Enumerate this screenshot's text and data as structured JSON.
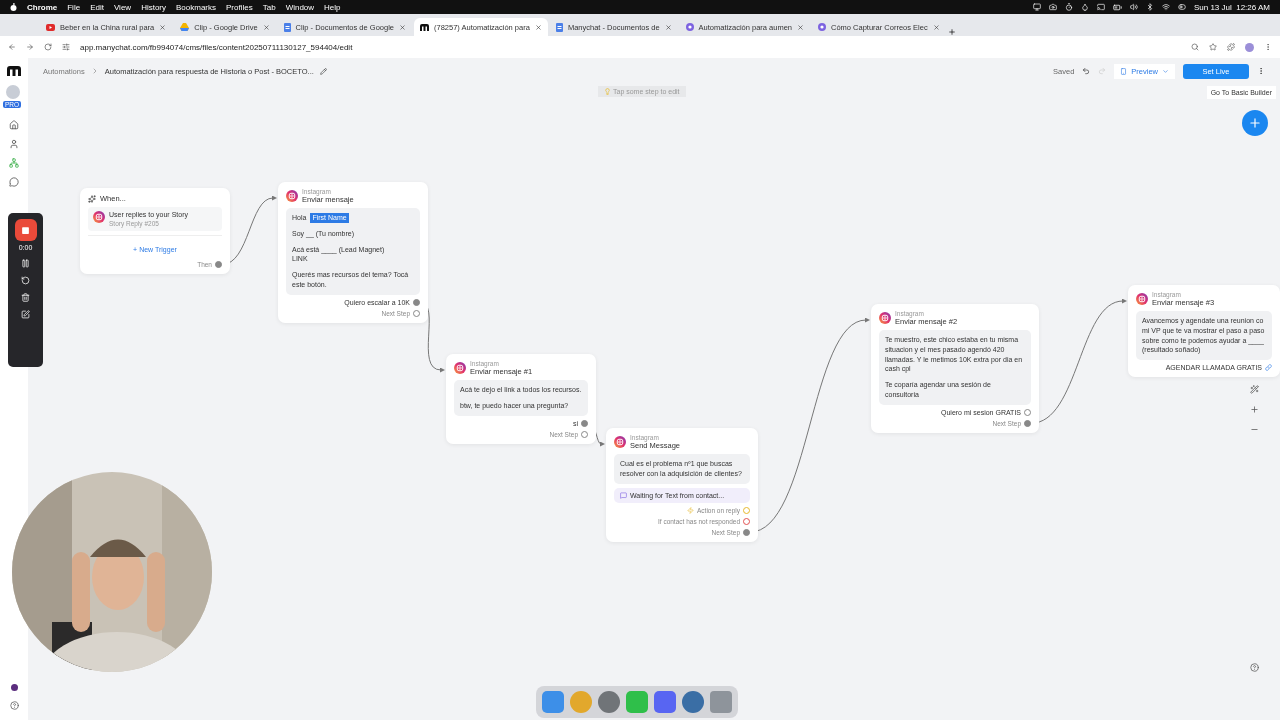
{
  "menu_bar": {
    "app": "Chrome",
    "menus": [
      "File",
      "Edit",
      "View",
      "History",
      "Bookmarks",
      "Profiles",
      "Tab",
      "Window",
      "Help"
    ],
    "clock": "Sun 13 Jul  12:26 AM"
  },
  "tabs": [
    {
      "title": "Beber en la China rural para",
      "kind": "video",
      "selected": false
    },
    {
      "title": "Clip - Google Drive",
      "kind": "drive",
      "selected": false
    },
    {
      "title": "Clip - Documentos de Google",
      "kind": "doc",
      "selected": false
    },
    {
      "title": "(78257) Automatización para",
      "kind": "app",
      "selected": true
    },
    {
      "title": "Manychat - Documentos de",
      "kind": "doc",
      "selected": false
    },
    {
      "title": "Automatización para aumen",
      "kind": "site",
      "selected": false
    },
    {
      "title": "Cómo Capturar Correos Elec",
      "kind": "site",
      "selected": false
    }
  ],
  "address_bar": {
    "url": "app.manychat.com/fb994074/cms/files/content20250711130127_594404/edit"
  },
  "sidebar": {
    "badge": "PRO"
  },
  "header": {
    "breadcrumb": "Automations",
    "title": "Automatización para respuesta de Historia o Post - BOCETO...",
    "status": "Saved",
    "preview": "Preview",
    "publish": "Set Live",
    "builder_link": "Go To Basic Builder"
  },
  "canvas": {
    "hint": "Tap some step to edit",
    "trigger": {
      "title": "When...",
      "items": [
        {
          "label": "User replies to your Story",
          "detail": "Story Reply #205"
        }
      ],
      "add_label": "+ New Trigger",
      "output": "Then"
    },
    "steps": [
      {
        "channel": "Instagram",
        "title": "Enviar mensaje",
        "paragraphs": [
          {
            "text": "Hola",
            "variable": "First Name"
          },
          {
            "text": "Soy __ (Tu nombre)"
          },
          {
            "text": "Acá está ____ (Lead Magnet)\nLINK"
          },
          {
            "text": "Querés mas recursos del tema? Tocá este botón."
          }
        ],
        "buttons": [
          {
            "label": "Quiero escalar a 10K",
            "connected": true
          }
        ],
        "outputs": [
          {
            "label": "Next Step",
            "kind": "next",
            "connected": false
          }
        ]
      },
      {
        "channel": "Instagram",
        "title": "Enviar mensaje #1",
        "paragraphs": [
          {
            "text": "Acá te dejo el link a todos los recursos."
          },
          {
            "text": "btw, te puedo hacer una pregunta?"
          }
        ],
        "buttons": [
          {
            "label": "si",
            "connected": true
          }
        ],
        "outputs": [
          {
            "label": "Next Step",
            "kind": "next",
            "connected": false
          }
        ]
      },
      {
        "channel": "Instagram",
        "title": "Send Message",
        "paragraphs": [
          {
            "text": "Cual es el problema nº1 que buscas resolver con la adquisición de clientes?"
          }
        ],
        "waiting": "Waiting for Text from contact...",
        "outputs": [
          {
            "label": "Action on reply",
            "kind": "action",
            "connected": false
          },
          {
            "label": "If contact has not responded",
            "kind": "timeout",
            "connected": false
          },
          {
            "label": "Next Step",
            "kind": "next",
            "connected": true
          }
        ]
      },
      {
        "channel": "Instagram",
        "title": "Enviar mensaje #2",
        "paragraphs": [
          {
            "text": "Te muestro, este chico estaba en tu misma situacion y el mes pasado agendó 420 llamadas. Y le metimos 10K extra por dia en cash cpl"
          },
          {
            "text": "Te coparía agendar una sesión de consultoria"
          }
        ],
        "buttons": [
          {
            "label": "Quiero mi sesion GRATIS",
            "connected": false
          }
        ],
        "outputs": [
          {
            "label": "Next Step",
            "kind": "next",
            "connected": true
          }
        ]
      },
      {
        "channel": "Instagram",
        "title": "Enviar mensaje #3",
        "paragraphs": [
          {
            "text": "Avancemos y agendate una reunion co\nmi VP que te va mostrar el paso a paso\nsobre como te podemos ayudar a ____\n(resultado soñado)"
          }
        ],
        "buttons": [
          {
            "label": "AGENDAR LLAMADA GRATIS",
            "kind": "link"
          }
        ]
      }
    ]
  },
  "recorder": {
    "time": "0:00"
  }
}
